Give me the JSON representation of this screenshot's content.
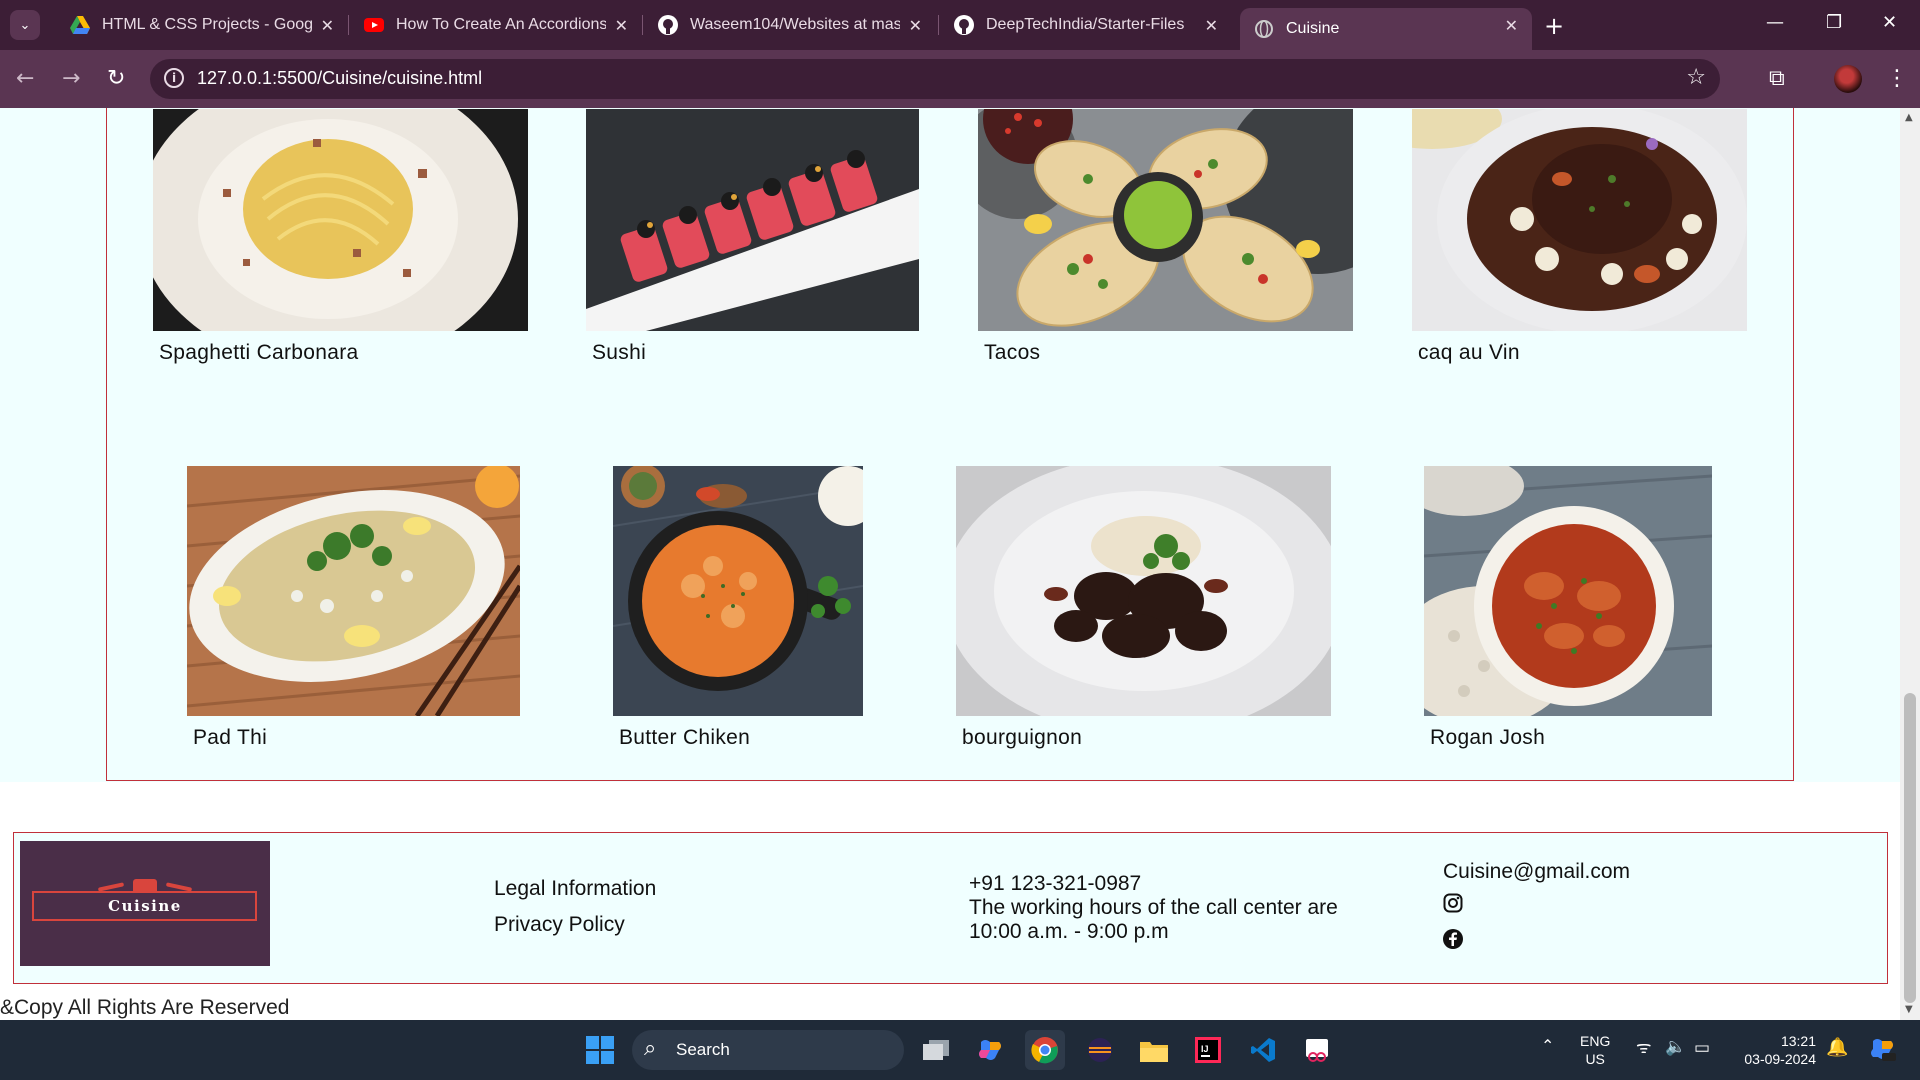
{
  "browser": {
    "tabs": [
      {
        "title": "HTML & CSS Projects - Google",
        "icon": "google-drive-icon"
      },
      {
        "title": "How To Create An Accordions In",
        "icon": "youtube-icon"
      },
      {
        "title": "Waseem104/Websites at master",
        "icon": "github-icon"
      },
      {
        "title": "DeepTechIndia/Starter-Files",
        "icon": "github-icon"
      },
      {
        "title": "Cuisine",
        "icon": "globe-icon",
        "active": true
      }
    ],
    "url": "127.0.0.1:5500/Cuisine/cuisine.html"
  },
  "dishes": [
    {
      "name": "Spaghetti Carbonara"
    },
    {
      "name": "Sushi"
    },
    {
      "name": "Tacos"
    },
    {
      "name": "caq au Vin"
    },
    {
      "name": "Pad Thi"
    },
    {
      "name": "Butter Chiken"
    },
    {
      "name": "bourguignon"
    },
    {
      "name": "Rogan Josh"
    }
  ],
  "footer": {
    "logo_text": "Cuisine",
    "legal": "Legal Information",
    "privacy": "Privacy Policy",
    "phone": "+91 123-321-0987",
    "hours_line1": "The working hours of the call center are",
    "hours_line2": "10:00 a.m. - 9:00 p.m",
    "email": "Cuisine@gmail.com",
    "copyright": "&Copy All Rights Are Reserved"
  },
  "taskbar": {
    "search_label": "Search",
    "lang_line1": "ENG",
    "lang_line2": "US",
    "time": "13:21",
    "date": "03-09-2024"
  },
  "colors": {
    "accent_border": "#c0303a",
    "page_bg": "#f0ffff",
    "chrome_dark": "#3c1e36",
    "chrome_mid": "#5a3552"
  }
}
